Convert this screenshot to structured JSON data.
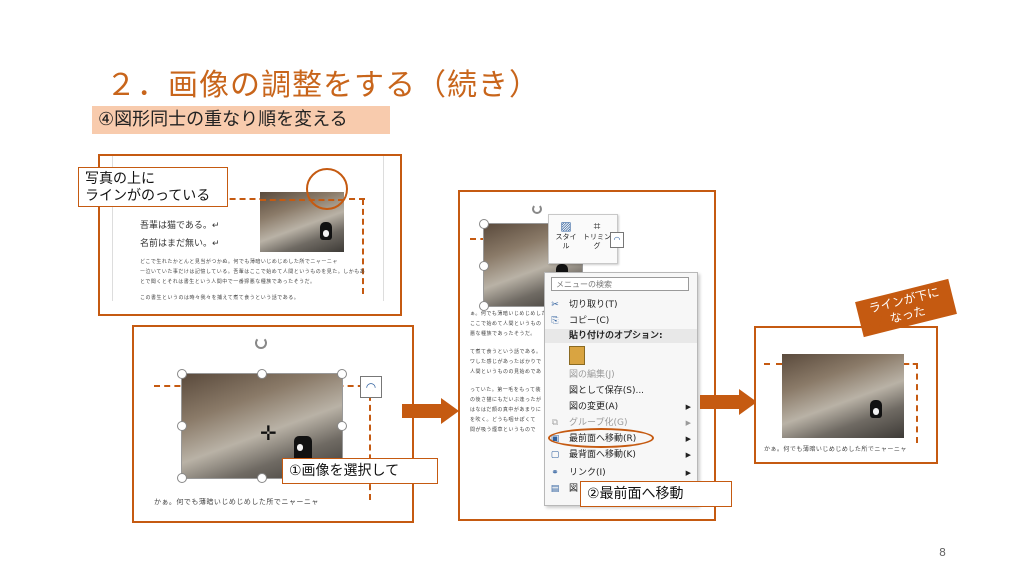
{
  "slide": {
    "title": "２．画像の調整をする（続き）",
    "subtitle": "④図形同士の重なり順を変える",
    "page_number": "8"
  },
  "panel1": {
    "callout": [
      "写真の上に",
      "ラインがのっている"
    ],
    "doc_lines": [
      "吾輩は猫である。↵",
      "名前はまだ無い。↵"
    ],
    "small_text": [
      "どこで生れたかとんと見当がつかぬ。何でも薄暗いじめじめした所でニャーニャ",
      "ー泣いていた事だけは記憶している。吾輩はここで始めて人間というものを見た。しかもあ",
      "とで聞くとそれは書生という人間中で一番獰悪な種族であったそうだ。",
      "この書生というのは時々我々を捕えて煮て食うという話である。"
    ]
  },
  "panel2": {
    "callout": "①画像を選択して",
    "small_text": "かぁ。何でも薄暗いじめじめした所でニャーニャ"
  },
  "panel3": {
    "callout": "②最前面へ移動",
    "mini_toolbar": {
      "style": "スタイル",
      "trim": "トリミング"
    },
    "menu": {
      "search_placeholder": "メニューの検索",
      "items": [
        {
          "label": "切り取り(T)",
          "icon": "scissors-icon",
          "glyph": "✂",
          "disabled": false,
          "submenu": false
        },
        {
          "label": "コピー(C)",
          "icon": "copy-icon",
          "glyph": "⎘",
          "disabled": false,
          "submenu": false
        }
      ],
      "paste_header": "貼り付けのオプション:",
      "items2": [
        {
          "label": "図の編集(J)",
          "icon": "",
          "glyph": "",
          "disabled": true,
          "submenu": false
        },
        {
          "label": "図として保存(S)...",
          "icon": "",
          "glyph": "",
          "disabled": false,
          "submenu": false
        },
        {
          "label": "図の変更(A)",
          "icon": "",
          "glyph": "",
          "disabled": false,
          "submenu": true
        },
        {
          "label": "グループ化(G)",
          "icon": "group-icon",
          "glyph": "⧉",
          "disabled": true,
          "submenu": true
        },
        {
          "label": "最前面へ移動(R)",
          "icon": "bring-front-icon",
          "glyph": "▣",
          "disabled": false,
          "submenu": true
        },
        {
          "label": "最背面へ移動(K)",
          "icon": "send-back-icon",
          "glyph": "▢",
          "disabled": false,
          "submenu": true
        },
        {
          "label": "リンク(I)",
          "icon": "link-icon",
          "glyph": "⚭",
          "disabled": false,
          "submenu": true
        },
        {
          "label": "図",
          "icon": "",
          "glyph": "▤",
          "disabled": false,
          "submenu": false
        }
      ]
    },
    "small_text": [
      "ぁ。何でも薄暗いじめじめした",
      "ここで始めて人間というもの",
      "悪な種族であったそうだ。",
      "て煮て食うという話である。",
      "ワした感じがあったばかりで",
      "人間というものの見始めであ",
      "っていた。第一毛をもって装",
      "の後さ猫にもだいぶ逢ったが",
      "はなはだ顔の真中があまりに",
      "を吹く。どうも咽せぽくて",
      "間が吸う煙草というもので"
    ]
  },
  "panel4": {
    "callout": [
      "ラインが下に",
      "なった"
    ],
    "small_text": "かぁ。何でも薄暗いじめじめした所でニャーニャ"
  },
  "colors": {
    "accent": "#c55a11",
    "title": "#c8651b",
    "subtitle_bg": "#f8cbad"
  }
}
